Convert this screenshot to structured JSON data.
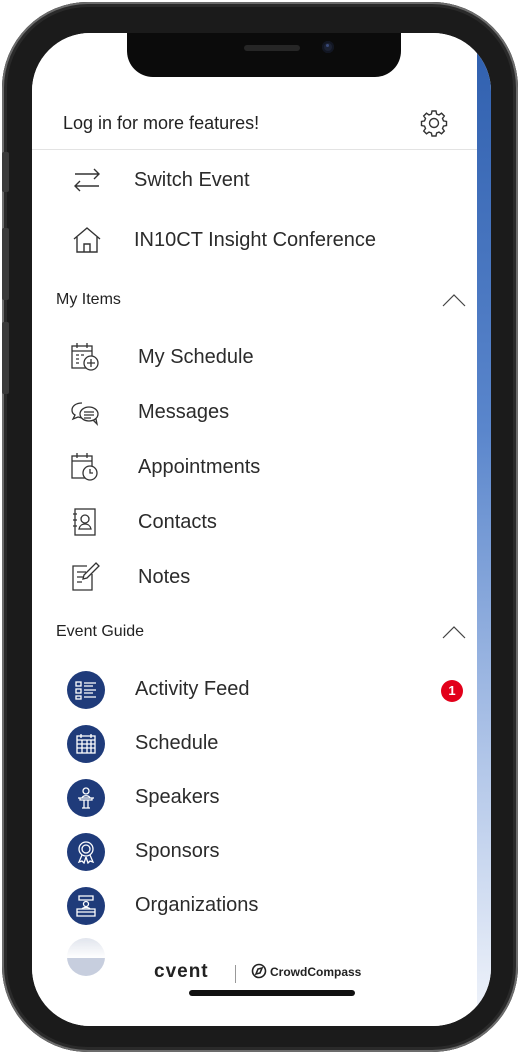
{
  "header": {
    "login_text": "Log in for more features!",
    "settings_icon": "gear-icon"
  },
  "top_items": [
    {
      "label": "Switch Event",
      "icon": "switch-arrows-icon"
    },
    {
      "label": "IN10CT Insight Conference",
      "icon": "home-icon"
    }
  ],
  "my_items": {
    "title": "My Items",
    "items": [
      {
        "label": "My Schedule",
        "icon": "calendar-add-icon"
      },
      {
        "label": "Messages",
        "icon": "chat-bubbles-icon"
      },
      {
        "label": "Appointments",
        "icon": "calendar-clock-icon"
      },
      {
        "label": "Contacts",
        "icon": "contact-book-icon"
      },
      {
        "label": "Notes",
        "icon": "note-pen-icon"
      }
    ]
  },
  "event_guide": {
    "title": "Event Guide",
    "items": [
      {
        "label": "Activity Feed",
        "icon": "feed-list-icon",
        "badge": "1"
      },
      {
        "label": "Schedule",
        "icon": "calendar-grid-icon"
      },
      {
        "label": "Speakers",
        "icon": "speaker-podium-icon"
      },
      {
        "label": "Sponsors",
        "icon": "award-ribbon-icon"
      },
      {
        "label": "Organizations",
        "icon": "exhibitor-booth-icon"
      }
    ]
  },
  "footer": {
    "brand": "cvent",
    "partner": "CrowdCompass"
  },
  "colors": {
    "accent_navy": "#1f3b7a",
    "badge_red": "#e2001a",
    "side_strip_blue": "#2f5fae"
  }
}
